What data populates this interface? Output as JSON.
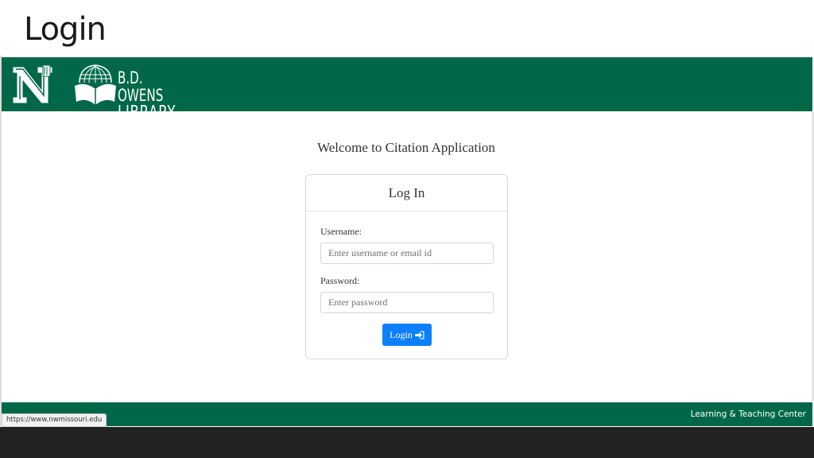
{
  "slide": {
    "title": "Login"
  },
  "header": {
    "logo_n": "N",
    "library_line1": "B.D. OWENS",
    "library_line2": "LIBRARY"
  },
  "page": {
    "welcome": "Welcome to Citation Application"
  },
  "login_card": {
    "title": "Log In",
    "username_label": "Username:",
    "username_placeholder": "Enter username or email id",
    "password_label": "Password:",
    "password_placeholder": "Enter password",
    "submit_label": "Login",
    "submit_icon": "sign-in-icon"
  },
  "footer": {
    "text": "Learning & Teaching Center"
  },
  "status_bar": {
    "url": "https://www.nwmissouri.edu"
  },
  "colors": {
    "brand_green": "#006848",
    "button_blue": "#0d7ffb"
  }
}
